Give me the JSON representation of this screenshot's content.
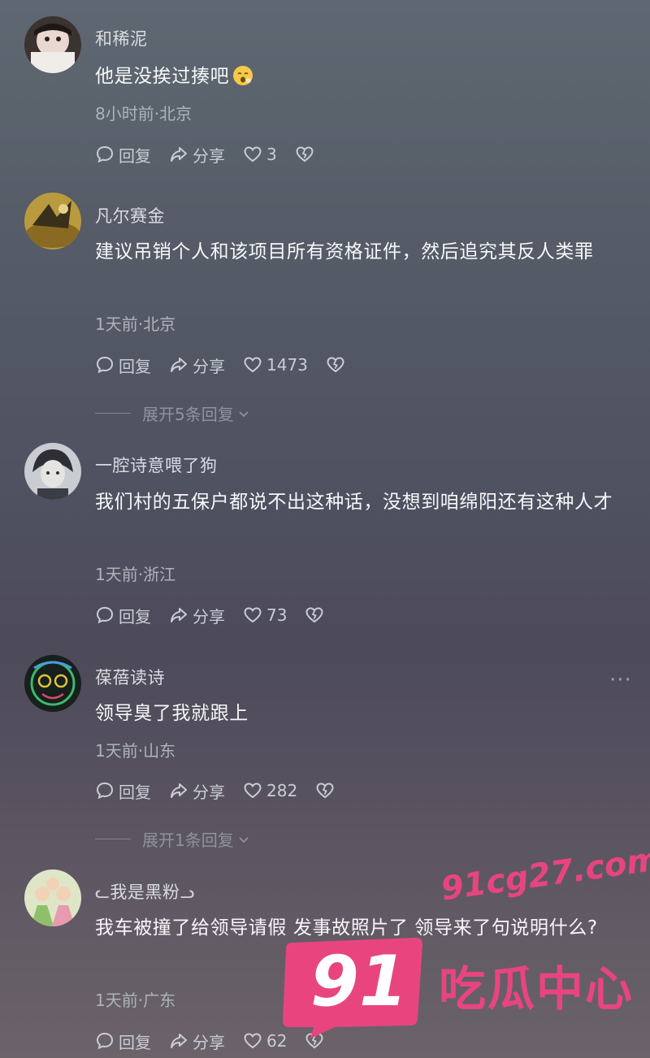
{
  "comments": [
    {
      "username": "和稀泥",
      "text": "他是没挨过揍吧",
      "meta": "8小时前·北京",
      "reply_label": "回复",
      "share_label": "分享",
      "likes": "3"
    },
    {
      "username": "凡尔赛金",
      "text": "建议吊销个人和该项目所有资格证件，然后追究其反人类罪",
      "meta": "1天前·北京",
      "reply_label": "回复",
      "share_label": "分享",
      "likes": "1473",
      "expand_label": "展开5条回复"
    },
    {
      "username": "一腔诗意喂了狗",
      "text": "我们村的五保户都说不出这种话，没想到咱绵阳还有这种人才",
      "meta": "1天前·浙江",
      "reply_label": "回复",
      "share_label": "分享",
      "likes": "73"
    },
    {
      "username": "葆蓓读诗",
      "text": "领导臭了我就跟上",
      "meta": "1天前·山东",
      "reply_label": "回复",
      "share_label": "分享",
      "likes": "282",
      "expand_label": "展开1条回复"
    },
    {
      "username": "我是黑粉",
      "text": "我车被撞了给领导请假 发事故照片了 领导来了句说明什么?",
      "meta": "1天前·广东",
      "reply_label": "回复",
      "share_label": "分享",
      "likes": "62"
    }
  ],
  "more_label": "···",
  "watermark": {
    "number": "91",
    "url": "91cg27.com",
    "brand": "吃瓜中心"
  },
  "icons": {
    "reply": "comment-bubble-icon",
    "share": "share-arrow-icon",
    "like": "heart-icon",
    "dislike": "broken-heart-icon",
    "expand": "chevron-down-icon"
  },
  "colors": {
    "text": "#f6f7f9",
    "secondary": "#aeb3bb",
    "watermark": "#e8457f"
  }
}
